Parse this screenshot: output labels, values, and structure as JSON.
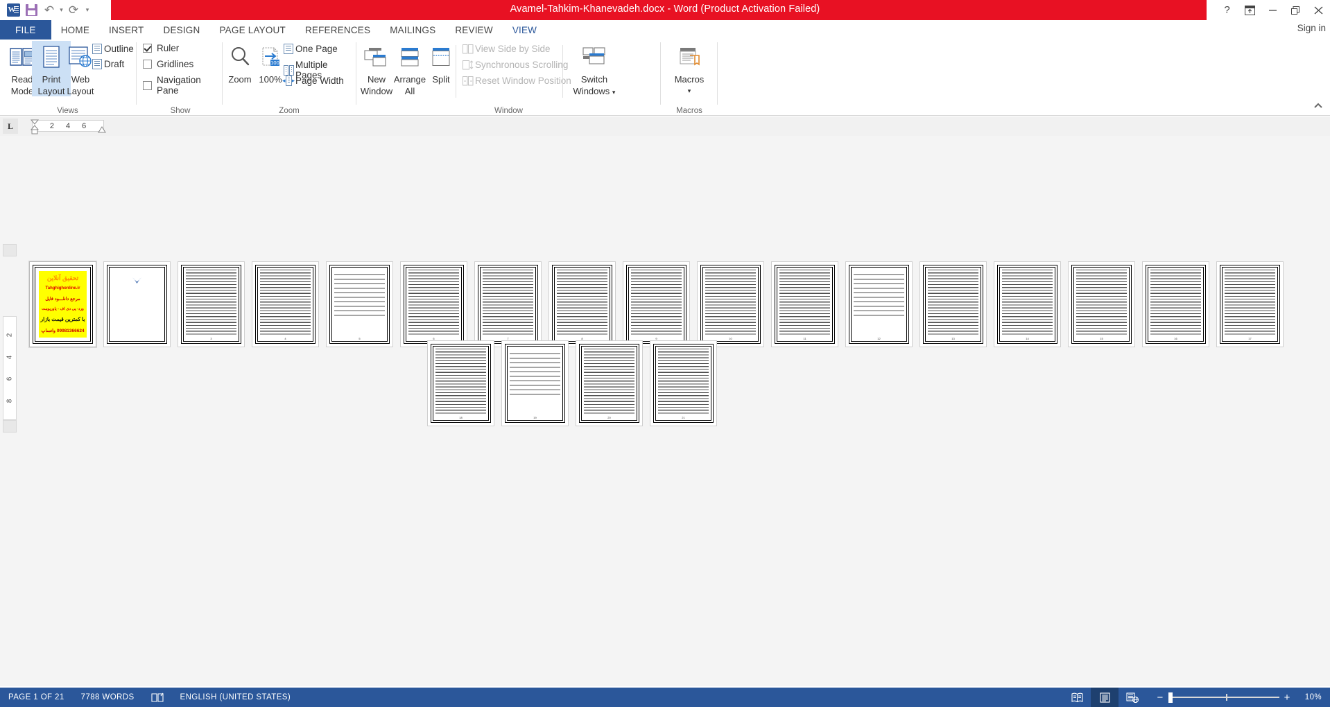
{
  "titlebar": {
    "document_title": "Avamel-Tahkim-Khanevadeh.docx  -  Word (Product Activation Failed)",
    "qat": {
      "app_icon": "word-logo-icon",
      "save": "save-icon",
      "undo": "undo-icon",
      "redo": "redo-icon",
      "customize": "customize-quick-access-toolbar-icon"
    },
    "controls": {
      "help": "?",
      "ribbon_display": "ribbon-display-options-icon",
      "minimize": "minimize-icon",
      "restore": "restore-icon",
      "close": "close-icon"
    },
    "accent_red": "#e81123",
    "word_blue": "#2b579a"
  },
  "tabs": {
    "file_label": "FILE",
    "items": [
      {
        "label": "HOME",
        "active": false
      },
      {
        "label": "INSERT",
        "active": false
      },
      {
        "label": "DESIGN",
        "active": false
      },
      {
        "label": "PAGE LAYOUT",
        "active": false
      },
      {
        "label": "REFERENCES",
        "active": false
      },
      {
        "label": "MAILINGS",
        "active": false
      },
      {
        "label": "REVIEW",
        "active": false
      },
      {
        "label": "VIEW",
        "active": true
      }
    ],
    "sign_in": "Sign in"
  },
  "ribbon": {
    "groups": [
      {
        "name": "Views"
      },
      {
        "name": "Show"
      },
      {
        "name": "Zoom"
      },
      {
        "name": "Window"
      },
      {
        "name": "Macros"
      }
    ],
    "views": {
      "read_mode": "Read\nMode",
      "read_mode_l1": "Read",
      "read_mode_l2": "Mode",
      "print_layout_l1": "Print",
      "print_layout_l2": "Layout",
      "web_layout_l1": "Web",
      "web_layout_l2": "Layout",
      "outline": "Outline",
      "draft": "Draft",
      "selected": "Print Layout"
    },
    "show": {
      "ruler": "Ruler",
      "ruler_checked": true,
      "gridlines": "Gridlines",
      "gridlines_checked": false,
      "navigation_pane": "Navigation Pane",
      "navigation_pane_checked": false
    },
    "zoom": {
      "zoom_button": "Zoom",
      "hundred_percent": "100%",
      "one_page": "One Page",
      "multiple_pages": "Multiple Pages",
      "page_width": "Page Width"
    },
    "window": {
      "new_window_l1": "New",
      "new_window_l2": "Window",
      "arrange_all_l1": "Arrange",
      "arrange_all_l2": "All",
      "split": "Split",
      "view_side_by_side": "View Side by Side",
      "synchronous_scrolling": "Synchronous Scrolling",
      "reset_window_position": "Reset Window Position",
      "disabled_items": true
    },
    "macros": {
      "macros_l1": "Macros",
      "dropdown": "▾"
    },
    "collapse": "⌃"
  },
  "ruler": {
    "tab_selector": "L",
    "marks": [
      "2",
      "4",
      "6"
    ],
    "vertical_marks": [
      "2",
      "4",
      "6",
      "8"
    ]
  },
  "document": {
    "total_pages": 21,
    "selected_page": 1,
    "row1_count": 17,
    "row2_count": 4,
    "page1": {
      "kind": "advert",
      "line1": "تحقیق آنلاین",
      "line2": "Tahghighonline.ir",
      "line3": "مرجع دانلـــود فایل",
      "line4": "ورد- پی دی اف - پاورپوینت",
      "line5": "با کمترین قیمت بازار",
      "line6": "09981366624 واتساپ",
      "bg_color": "#ffff00"
    },
    "page2": {
      "kind": "title-page",
      "logo": "university-logo-icon"
    }
  },
  "statusbar": {
    "page_indicator": "PAGE 1 OF 21",
    "word_count": "7788 WORDS",
    "proofing_icon": "proofing-errors-icon",
    "language": "ENGLISH (UNITED STATES)",
    "views": {
      "read_mode": "read-mode-icon",
      "print_layout": "print-layout-icon",
      "web_layout": "web-layout-icon",
      "active": "print-layout-icon"
    },
    "zoom_out": "−",
    "zoom_in": "+",
    "zoom_level": "10%",
    "bg_color": "#2b579a"
  }
}
